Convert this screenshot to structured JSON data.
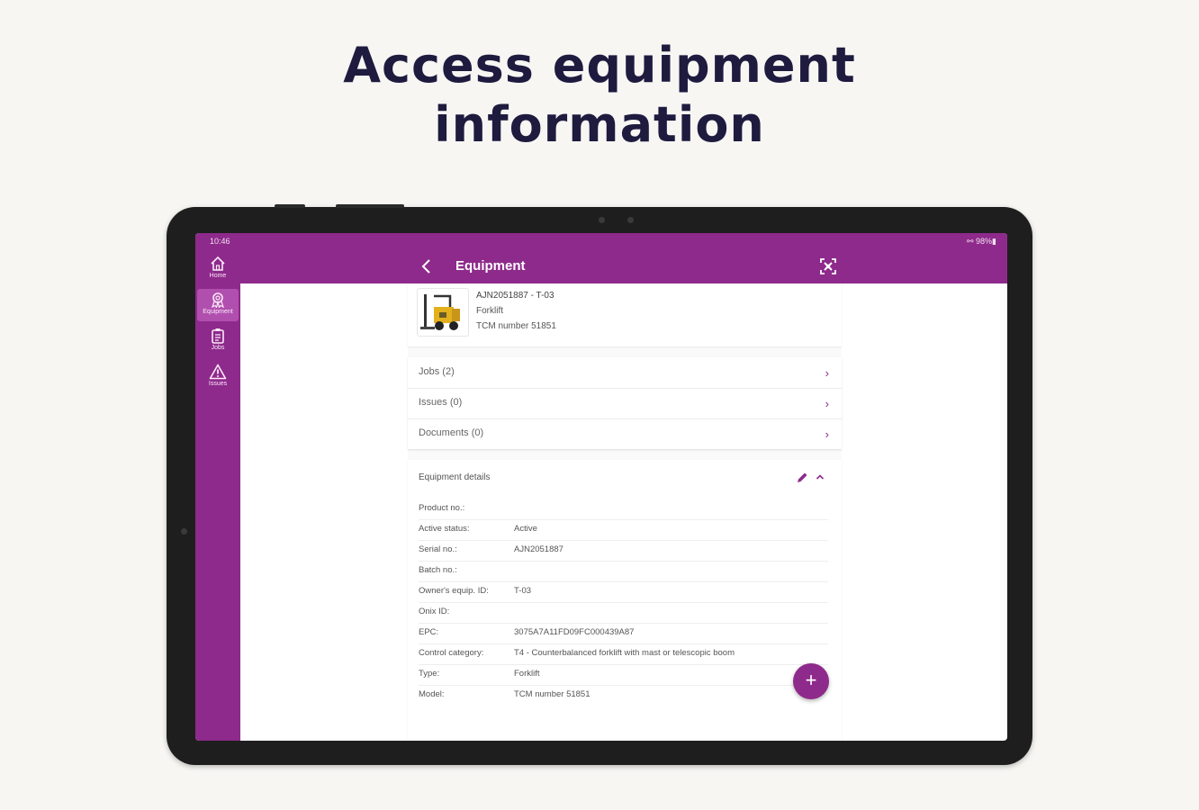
{
  "headline": {
    "line1": "Access equipment",
    "line2": "information"
  },
  "statusbar": {
    "time": "10:46",
    "right": "⚯ 98%▮"
  },
  "rail": {
    "items": [
      {
        "label": "Home",
        "icon": "home-icon"
      },
      {
        "label": "Equipment",
        "icon": "equipment-icon",
        "active": true
      },
      {
        "label": "Jobs",
        "icon": "clipboard-icon"
      },
      {
        "label": "Issues",
        "icon": "warning-icon"
      }
    ]
  },
  "appbar": {
    "title": "Equipment"
  },
  "equipment": {
    "title": "AJN2051887 - T-03",
    "type": "Forklift",
    "model": "TCM number 51851"
  },
  "nav": [
    {
      "label": "Jobs (2)"
    },
    {
      "label": "Issues (0)"
    },
    {
      "label": "Documents (0)"
    }
  ],
  "details": {
    "title": "Equipment details",
    "rows": [
      {
        "key": "Product no.:",
        "value": ""
      },
      {
        "key": "Active status:",
        "value": "Active"
      },
      {
        "key": "Serial no.:",
        "value": "AJN2051887"
      },
      {
        "key": "Batch no.:",
        "value": ""
      },
      {
        "key": "Owner's equip. ID:",
        "value": "T-03"
      },
      {
        "key": "Onix ID:",
        "value": ""
      },
      {
        "key": "EPC:",
        "value": "3075A7A11FD09FC000439A87"
      },
      {
        "key": "Control category:",
        "value": "T4 - Counterbalanced forklift with mast or telescopic boom"
      },
      {
        "key": "Type:",
        "value": "Forklift"
      },
      {
        "key": "Model:",
        "value": "TCM number 51851"
      }
    ]
  },
  "fab": {
    "label": "+"
  },
  "colors": {
    "brand": "#8e2a8b",
    "headline": "#1e1b3f",
    "background": "#f7f6f3"
  }
}
